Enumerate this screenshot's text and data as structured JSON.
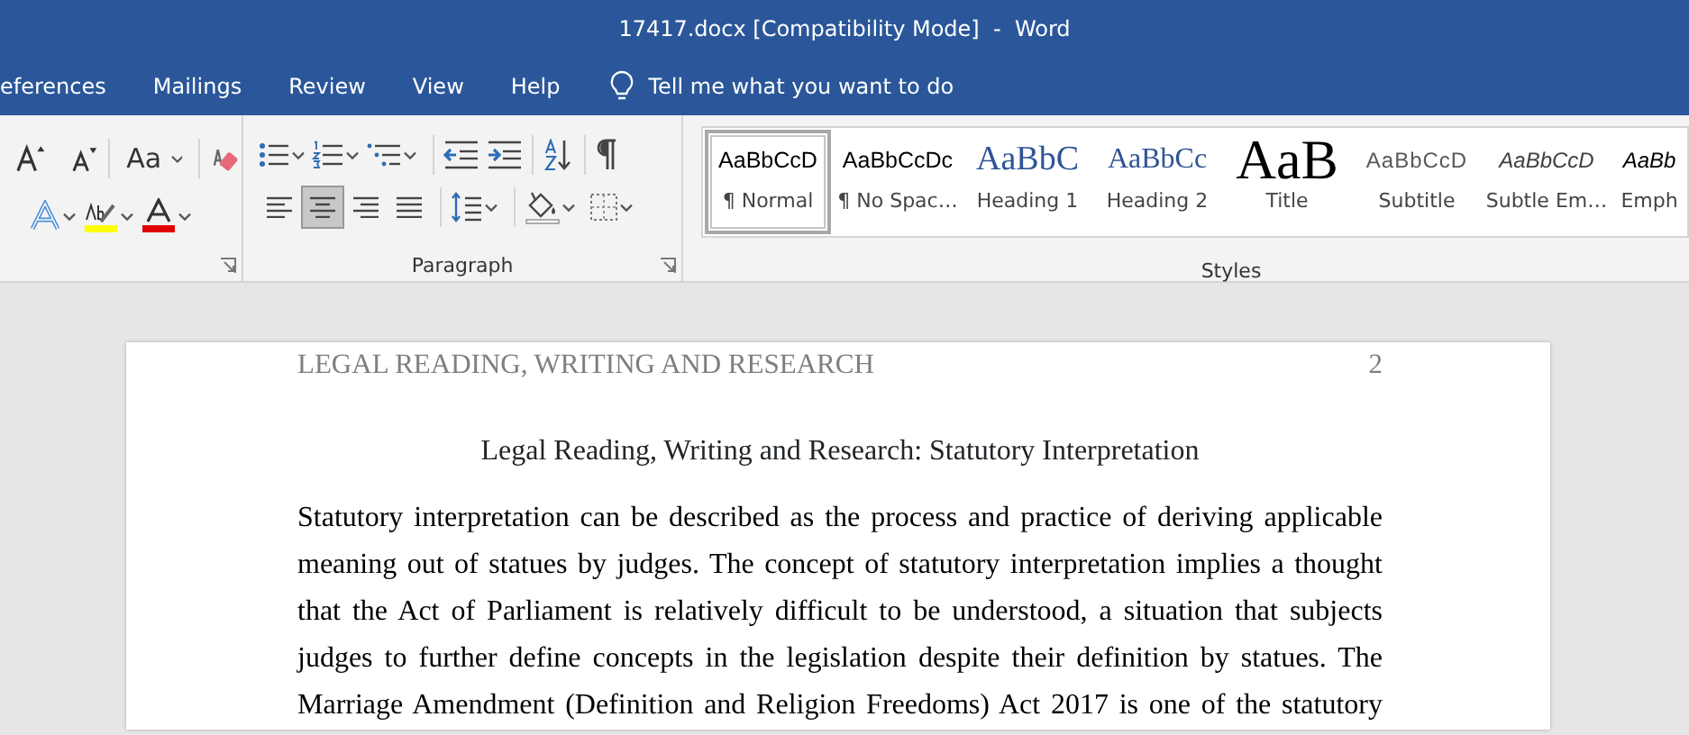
{
  "window": {
    "title": "17417.docx [Compatibility Mode]  -  Word"
  },
  "ribbon_tabs": [
    {
      "label": "eferences",
      "selected": false
    },
    {
      "label": "Mailings",
      "selected": false
    },
    {
      "label": "Review",
      "selected": false
    },
    {
      "label": "View",
      "selected": false
    },
    {
      "label": "Help",
      "selected": false
    }
  ],
  "tell_me": {
    "text": "Tell me what you want to do"
  },
  "font_group": {
    "change_case": "Aa"
  },
  "paragraph_group": {
    "label": "Paragraph",
    "alignments": [
      {
        "kind": "left",
        "selected": false
      },
      {
        "kind": "center",
        "selected": true
      },
      {
        "kind": "right",
        "selected": false
      },
      {
        "kind": "justify",
        "selected": false
      }
    ]
  },
  "styles_group": {
    "label": "Styles",
    "items": [
      {
        "kind": "normal",
        "preview": "AaBbCcD",
        "name": "¶ Normal",
        "selected": true
      },
      {
        "kind": "nospacing",
        "preview": "AaBbCcDc",
        "name": "¶ No Spac…",
        "selected": false
      },
      {
        "kind": "heading1",
        "preview": "AaBbC",
        "name": "Heading 1",
        "selected": false
      },
      {
        "kind": "heading2",
        "preview": "AaBbCc",
        "name": "Heading 2",
        "selected": false
      },
      {
        "kind": "title",
        "preview": "AaB",
        "name": "Title",
        "selected": false
      },
      {
        "kind": "subtitle",
        "preview": "AaBbCcD",
        "name": "Subtitle",
        "selected": false
      },
      {
        "kind": "subtle",
        "preview": "AaBbCcD",
        "name": "Subtle Em…",
        "selected": false
      },
      {
        "kind": "emphasis",
        "preview": "AaBb",
        "name": "Emph",
        "selected": false
      }
    ]
  },
  "document": {
    "header": "LEGAL READING, WRITING AND RESEARCH",
    "page_number": "2",
    "title": "Legal Reading, Writing and Research: Statutory Interpretation",
    "paragraph": "Statutory interpretation can be described as the process and practice of deriving applicable meaning out of statues by judges. The concept of statutory interpretation implies a thought that the Act of Parliament is relatively difficult to be understood, a situation that subjects judges to further define concepts in the legislation despite their definition by statues. The Marriage Amendment (Definition and Religion Freedoms) Act 2017 is one of the statutory"
  }
}
